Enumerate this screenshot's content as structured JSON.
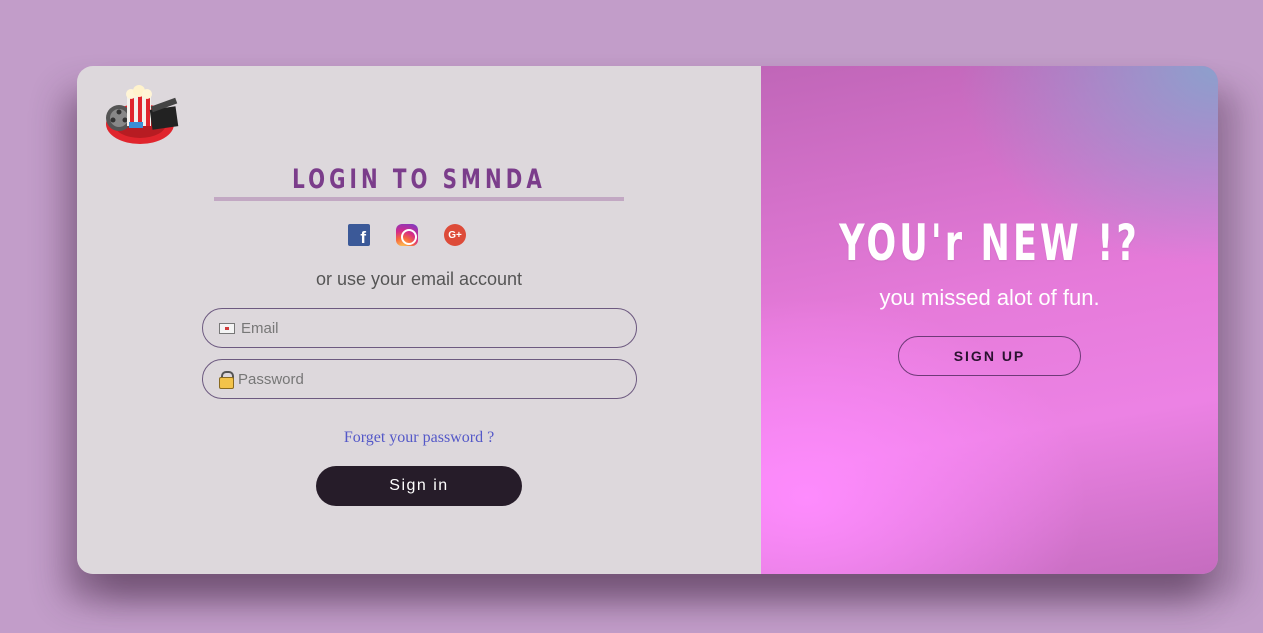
{
  "login": {
    "title": "LOGIN TO SMNDA",
    "socials": [
      {
        "name": "facebook",
        "icon": "facebook-icon",
        "glyph": "f"
      },
      {
        "name": "instagram",
        "icon": "instagram-icon",
        "glyph": ""
      },
      {
        "name": "google-plus",
        "icon": "google-plus-icon",
        "glyph": "G+"
      }
    ],
    "email_hint": "or use your email account",
    "email_placeholder": "Email",
    "password_placeholder": "Password",
    "forget_link": "Forget your password ?",
    "signin_label": "Sign in"
  },
  "promo": {
    "title": "YOU'r NEW !?",
    "subtitle": "you missed alot of fun.",
    "signup_label": "SIGN UP"
  },
  "colors": {
    "background": "#c29dc9",
    "left_panel": "#ddd8dc",
    "title": "#7b3d8b",
    "signin_button": "#261c29",
    "link": "#5458c8",
    "promo_pink": "#e57ad9"
  },
  "icons": {
    "logo": "cinema-logo-icon",
    "email": "mail-icon",
    "password": "lock-icon"
  }
}
